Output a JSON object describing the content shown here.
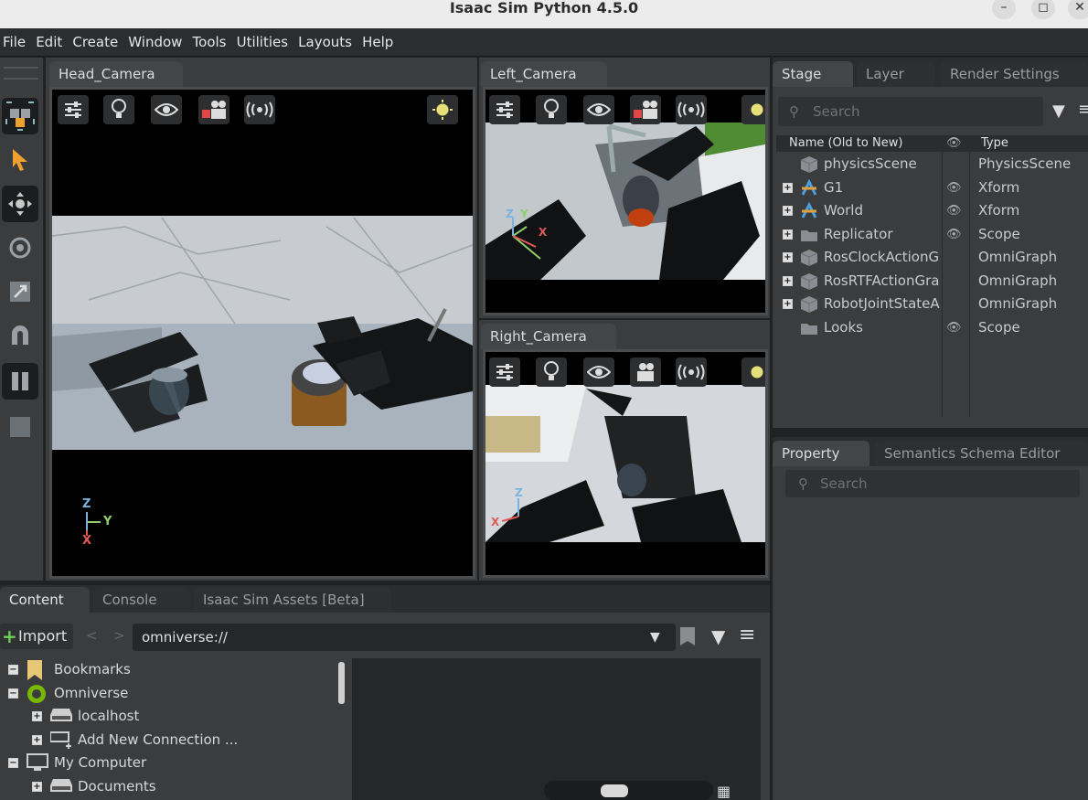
{
  "window": {
    "title": "Isaac Sim Python 4.5.0"
  },
  "menu": [
    "File",
    "Edit",
    "Create",
    "Window",
    "Tools",
    "Utilities",
    "Layouts",
    "Help"
  ],
  "viewports": {
    "head": {
      "tab": "Head_Camera"
    },
    "left": {
      "tab": "Left_Camera"
    },
    "right": {
      "tab": "Right_Camera"
    }
  },
  "axes": {
    "z": "Z",
    "y": "Y",
    "x": "X"
  },
  "stage": {
    "tabs": [
      "Stage",
      "Layer",
      "Render Settings"
    ],
    "search_placeholder": "Search",
    "col_name": "Name (Old to New)",
    "col_type": "Type",
    "rows": [
      {
        "name": "physicsScene",
        "type": "PhysicsScene",
        "expand": false,
        "visible": false,
        "icon": "cube-icon"
      },
      {
        "name": "G1",
        "type": "Xform",
        "expand": true,
        "visible": true,
        "icon": "xform-icon"
      },
      {
        "name": "World",
        "type": "Xform",
        "expand": true,
        "visible": true,
        "icon": "xform-icon"
      },
      {
        "name": "Replicator",
        "type": "Scope",
        "expand": true,
        "visible": true,
        "icon": "folder-icon"
      },
      {
        "name": "RosClockActionG",
        "type": "OmniGraph",
        "expand": true,
        "visible": false,
        "icon": "cube-icon"
      },
      {
        "name": "RosRTFActionGra",
        "type": "OmniGraph",
        "expand": true,
        "visible": false,
        "icon": "cube-icon"
      },
      {
        "name": "RobotJointStateA",
        "type": "OmniGraph",
        "expand": true,
        "visible": false,
        "icon": "cube-icon"
      },
      {
        "name": "Looks",
        "type": "Scope",
        "expand": false,
        "visible": true,
        "icon": "folder-icon"
      }
    ]
  },
  "property": {
    "tabs": [
      "Property",
      "Semantics Schema Editor"
    ],
    "search_placeholder": "Search"
  },
  "content": {
    "tabs": [
      "Content",
      "Console",
      "Isaac Sim Assets [Beta]"
    ],
    "import_label": "Import",
    "path": "omniverse://",
    "tree": [
      {
        "label": "Bookmarks",
        "level": 0,
        "expanded": true,
        "icon": "bookmark-icon"
      },
      {
        "label": "Omniverse",
        "level": 0,
        "expanded": true,
        "icon": "omniverse-icon"
      },
      {
        "label": "localhost",
        "level": 1,
        "expanded": false,
        "icon": "server-icon"
      },
      {
        "label": "Add New Connection ...",
        "level": 1,
        "expanded": false,
        "icon": "add-server-icon"
      },
      {
        "label": "My Computer",
        "level": 0,
        "expanded": true,
        "icon": "computer-icon"
      },
      {
        "label": "Documents",
        "level": 1,
        "expanded": false,
        "icon": "drive-icon"
      }
    ]
  },
  "colors": {
    "accent_orange": "#f0a030",
    "bg_dark": "#1f2123",
    "panel": "#3a3c3e"
  }
}
